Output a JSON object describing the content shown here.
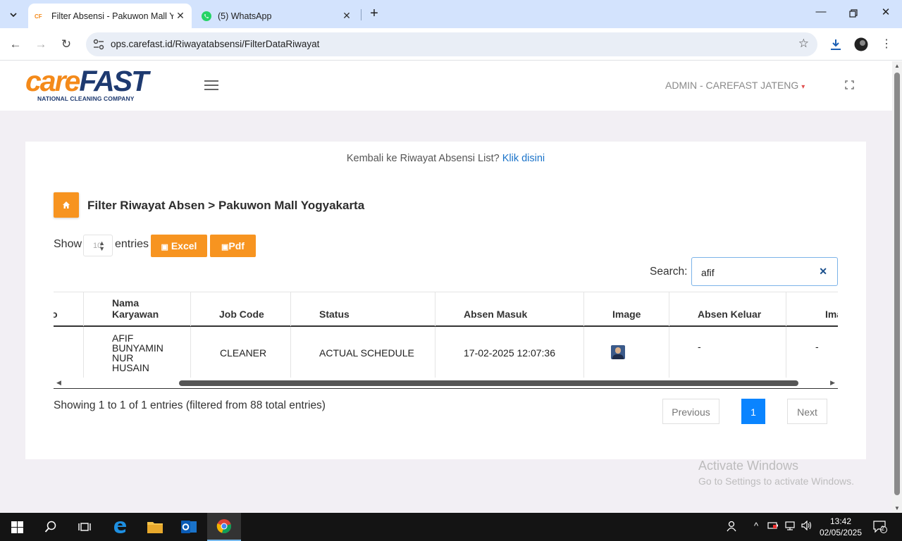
{
  "browser": {
    "tabs": [
      {
        "title": "Filter Absensi - Pakuwon Mall Y"
      },
      {
        "title": "(5) WhatsApp"
      }
    ],
    "url": "ops.carefast.id/Riwayatabsensi/FilterDataRiwayat"
  },
  "header": {
    "logo": {
      "care": "care",
      "fast": "FAST",
      "tagline": "NATIONAL CLEANING COMPANY"
    },
    "user_menu": "ADMIN - CAREFAST JATENG"
  },
  "card": {
    "back_text": "Kembali ke Riwayat Absensi List?",
    "back_link": "Klik disini",
    "page_title": "Filter Riwayat Absen > Pakuwon Mall Yogyakarta",
    "show_label": "Show",
    "entries_label": "entries",
    "page_length": "10",
    "excel_label": "Excel",
    "pdf_label": "Pdf",
    "search_label": "Search:",
    "search_value": "afif"
  },
  "table": {
    "columns": [
      "o",
      "Nama Karyawan",
      "Job Code",
      "Status",
      "Absen Masuk",
      "Image",
      "Absen Keluar",
      "Imag"
    ],
    "rows": [
      {
        "nama": "AFIF BUNYAMIN NUR HUSAIN",
        "job_code": "CLEANER",
        "status": "ACTUAL SCHEDULE",
        "absen_masuk": "17-02-2025 12:07:36",
        "absen_keluar": "-",
        "image2": "-"
      }
    ]
  },
  "footer": {
    "info": "Showing 1 to 1 of 1 entries (filtered from 88 total entries)",
    "previous": "Previous",
    "current_page": "1",
    "next": "Next"
  },
  "watermark": {
    "line1": "Activate Windows",
    "line2": "Go to Settings to activate Windows."
  },
  "taskbar": {
    "time": "13:42",
    "date": "02/05/2025",
    "notification_count": "2"
  }
}
